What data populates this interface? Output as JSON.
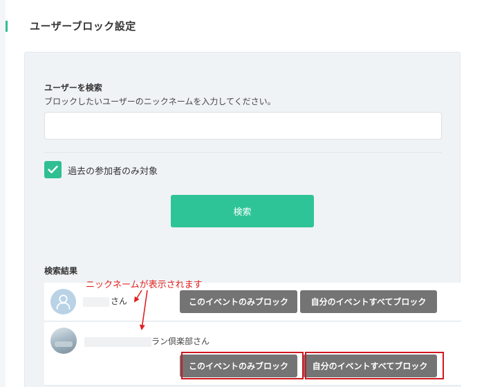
{
  "page": {
    "title": "ユーザーブロック設定"
  },
  "search": {
    "label": "ユーザーを検索",
    "description": "ブロックしたいユーザーのニックネームを入力してください。",
    "value": "",
    "placeholder": "",
    "past_only_label": "過去の参加者のみ対象",
    "past_only_checked": true,
    "button_label": "検索"
  },
  "results": {
    "title": "検索結果",
    "rows": [
      {
        "suffix": "さん",
        "avatar": "default-user-icon",
        "block_event_label": "このイベントのみブロック",
        "block_all_label": "自分のイベントすべてブロック"
      },
      {
        "name_visible": "ラン倶楽部",
        "suffix": "さん",
        "avatar": "photo",
        "block_event_label": "このイベントのみブロック",
        "block_all_label": "自分のイベントすべてブロック"
      }
    ]
  },
  "annotation": {
    "text": "ニックネームが表示されます"
  },
  "colors": {
    "accent": "#2fbf91",
    "button_gray": "#747474",
    "annotation_red": "#e02020"
  }
}
